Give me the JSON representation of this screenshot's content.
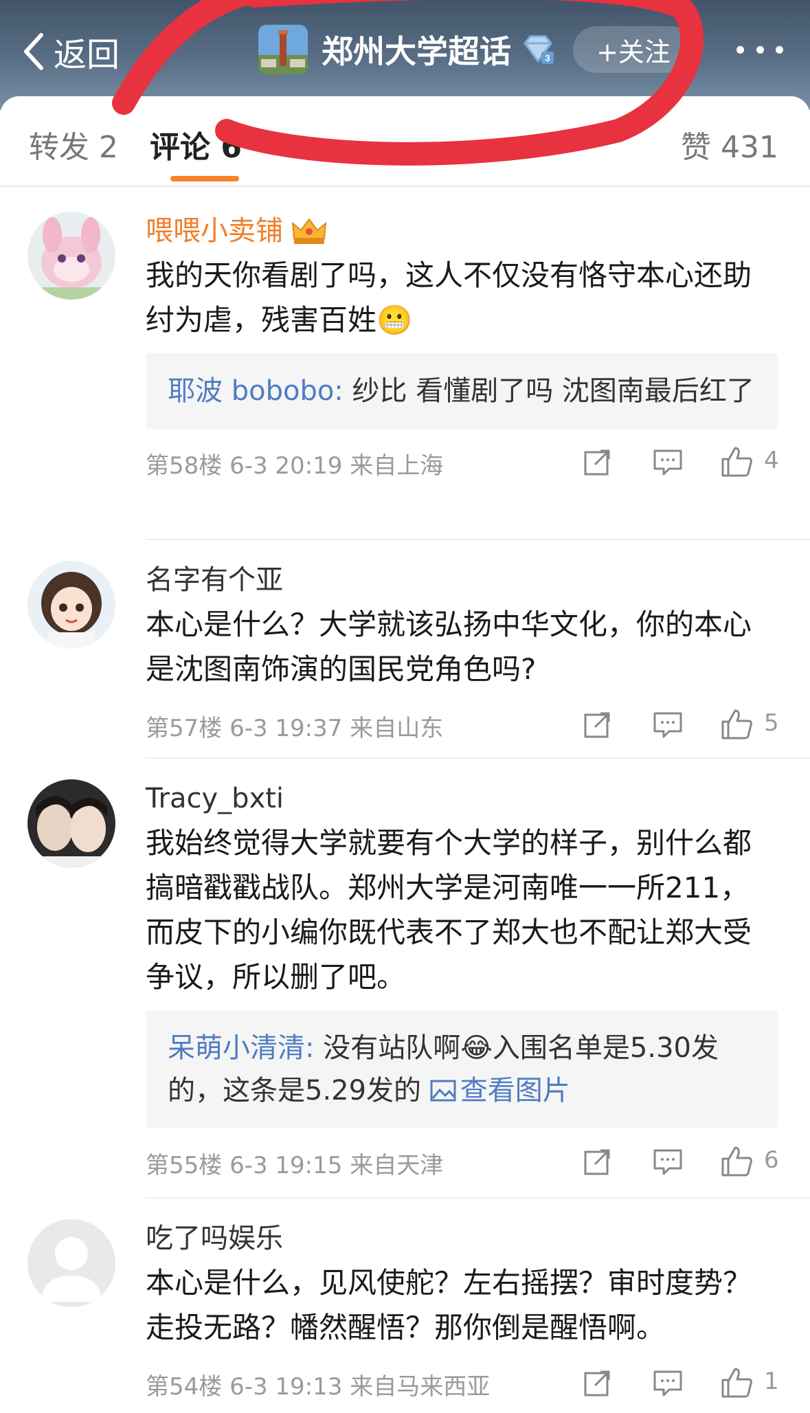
{
  "header": {
    "back_label": "返回",
    "title": "郑州大学超话",
    "follow_label": "+关注"
  },
  "tabs": {
    "repost": "转发 2",
    "comments": "评论 6",
    "likes": "赞 431"
  },
  "comments": [
    {
      "username": "喂喂小卖铺",
      "text": "我的天你看剧了吗，这人不仅没有恪守本心还助纣为虐，残害百姓😬",
      "reply_user": "耶波 bobobo:",
      "reply_text": " 纱比 看懂剧了吗 沈图南最后红了",
      "meta": "第58楼 6-3 20:19 来自上海",
      "likes": "4"
    },
    {
      "username": "名字有个亚",
      "text": "本心是什么？大学就该弘扬中华文化，你的本心是沈图南饰演的国民党角色吗?",
      "meta": "第57楼 6-3 19:37 来自山东",
      "likes": "5"
    },
    {
      "username": "Tracy_bxti",
      "text": "我始终觉得大学就要有个大学的样子，别什么都搞暗戳戳战队。郑州大学是河南唯一一所211，而皮下的小编你既代表不了郑大也不配让郑大受争议，所以删了吧。",
      "reply_user": "呆萌小清清:",
      "reply_text": " 没有站队啊😂入围名单是5.30发的，这条是5.29发的 ",
      "reply_link": "查看图片",
      "meta": "第55楼 6-3 19:15 来自天津",
      "likes": "6"
    },
    {
      "username": "吃了吗娱乐",
      "text": "本心是什么，见风使舵？左右摇摆？审时度势？走投无路？幡然醒悟？那你倒是醒悟啊。",
      "meta": "第54楼 6-3 19:13 来自马来西亚",
      "likes": "1"
    }
  ],
  "colors": {
    "header_bg": "#4a5d74",
    "accent_orange": "#f6822a",
    "link_blue": "#4f7cc1",
    "scribble_red": "#e8323f"
  }
}
